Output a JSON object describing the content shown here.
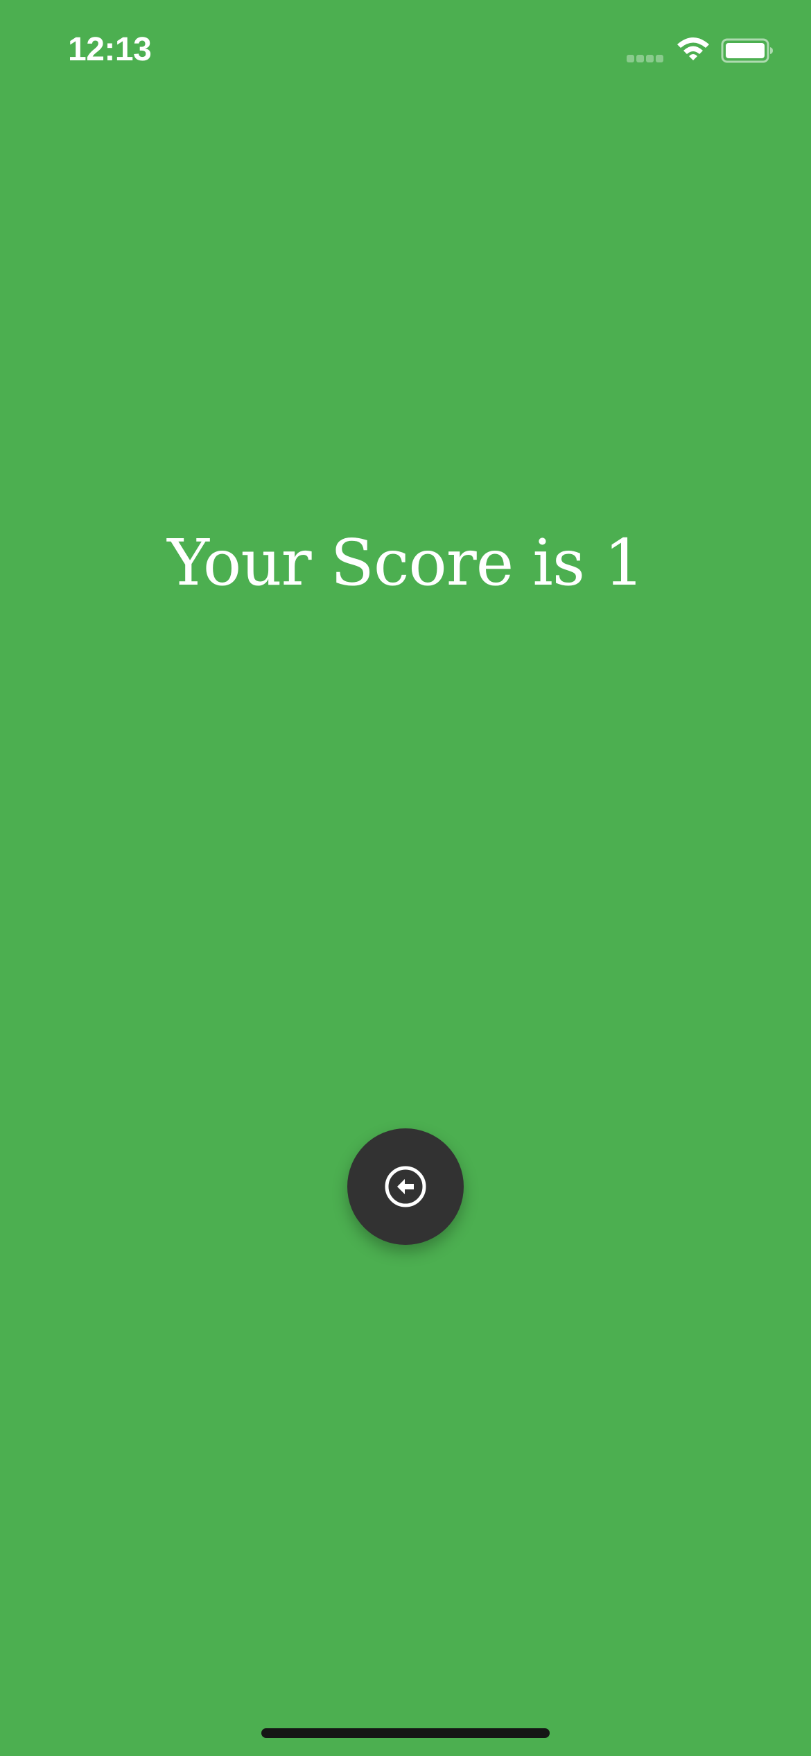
{
  "status_bar": {
    "time": "12:13",
    "signal_icon": "cellular-signal-dots-icon",
    "wifi_icon": "wifi-icon",
    "battery_icon": "battery-full-icon"
  },
  "main": {
    "score_text": "Your Score is 1"
  },
  "actions": {
    "back_button_icon": "arrow-left-circle-icon"
  },
  "colors": {
    "background": "#4caf50",
    "button": "#323232",
    "text": "#ffffff"
  }
}
